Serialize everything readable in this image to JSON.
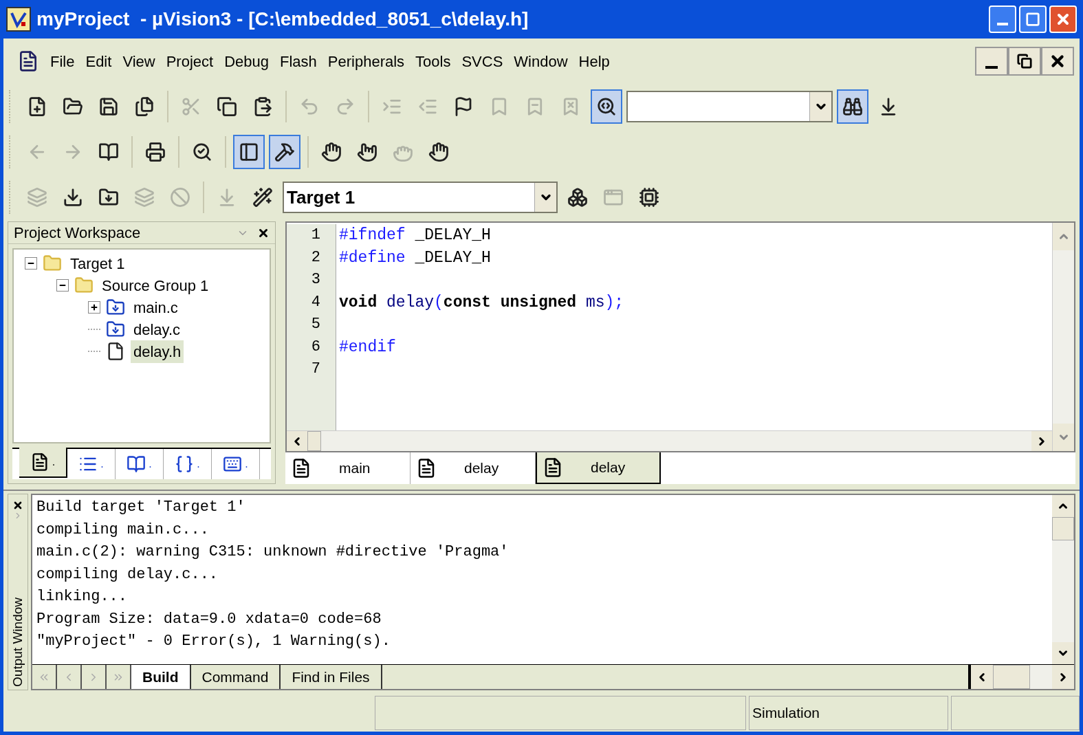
{
  "window": {
    "title": "myProject  - µVision3 - [C:\\embedded_8051_c\\delay.h]"
  },
  "menu": [
    "File",
    "Edit",
    "View",
    "Project",
    "Debug",
    "Flash",
    "Peripherals",
    "Tools",
    "SVCS",
    "Window",
    "Help"
  ],
  "toolbars": [
    {
      "items": [
        {
          "kind": "button",
          "disabled": false,
          "pressed": false
        },
        {
          "kind": "button",
          "disabled": false,
          "pressed": false
        },
        {
          "kind": "button",
          "disabled": false,
          "pressed": false
        },
        {
          "kind": "button",
          "disabled": false,
          "pressed": false
        },
        {
          "kind": "separator"
        },
        {
          "kind": "button",
          "disabled": true,
          "pressed": false
        },
        {
          "kind": "button",
          "disabled": false,
          "pressed": false
        },
        {
          "kind": "button",
          "disabled": false,
          "pressed": false
        },
        {
          "kind": "separator"
        },
        {
          "kind": "button",
          "disabled": true,
          "pressed": false
        },
        {
          "kind": "button",
          "disabled": true,
          "pressed": false
        },
        {
          "kind": "separator"
        },
        {
          "kind": "button",
          "disabled": true,
          "pressed": false
        },
        {
          "kind": "button",
          "disabled": true,
          "pressed": false
        },
        {
          "kind": "button",
          "disabled": false,
          "pressed": false
        },
        {
          "kind": "button",
          "disabled": true,
          "pressed": false
        },
        {
          "kind": "button",
          "disabled": true,
          "pressed": false
        },
        {
          "kind": "button",
          "disabled": true,
          "pressed": false
        },
        {
          "kind": "button",
          "disabled": false,
          "pressed": true
        },
        {
          "kind": "combo"
        },
        {
          "kind": "button",
          "disabled": false,
          "pressed": true
        },
        {
          "kind": "button",
          "disabled": false,
          "pressed": false
        }
      ]
    },
    {
      "items": [
        {
          "kind": "button",
          "disabled": true,
          "pressed": false
        },
        {
          "kind": "button",
          "disabled": true,
          "pressed": false
        },
        {
          "kind": "button",
          "disabled": false,
          "pressed": false
        },
        {
          "kind": "separator"
        },
        {
          "kind": "button",
          "disabled": false,
          "pressed": false
        },
        {
          "kind": "separator"
        },
        {
          "kind": "button",
          "disabled": false,
          "pressed": false
        },
        {
          "kind": "separator"
        },
        {
          "kind": "button",
          "disabled": false,
          "pressed": true
        },
        {
          "kind": "button",
          "disabled": false,
          "pressed": true
        },
        {
          "kind": "separator"
        },
        {
          "kind": "button",
          "disabled": false,
          "pressed": false
        },
        {
          "kind": "button",
          "disabled": false,
          "pressed": false
        },
        {
          "kind": "button",
          "disabled": true,
          "pressed": false
        },
        {
          "kind": "button",
          "disabled": false,
          "pressed": false
        }
      ]
    },
    {
      "items": [
        {
          "kind": "button",
          "disabled": true,
          "pressed": false
        },
        {
          "kind": "button",
          "disabled": false,
          "pressed": false
        },
        {
          "kind": "button",
          "disabled": false,
          "pressed": false
        },
        {
          "kind": "button",
          "disabled": true,
          "pressed": false
        },
        {
          "kind": "button",
          "disabled": true,
          "pressed": false
        },
        {
          "kind": "separator"
        },
        {
          "kind": "button",
          "disabled": true,
          "pressed": false
        },
        {
          "kind": "button",
          "disabled": false,
          "pressed": false
        },
        {
          "kind": "combo",
          "value": "Target 1"
        },
        {
          "kind": "button",
          "disabled": false,
          "pressed": false
        },
        {
          "kind": "button",
          "disabled": true,
          "pressed": false
        },
        {
          "kind": "button",
          "disabled": false,
          "pressed": false
        }
      ]
    }
  ],
  "workspace": {
    "title": "Project Workspace",
    "tree": [
      {
        "label": "Target 1",
        "kind": "target",
        "expanded": true,
        "children": [
          {
            "label": "Source Group 1",
            "kind": "group",
            "expanded": true,
            "children": [
              {
                "label": "main.c",
                "kind": "source",
                "expanded": false,
                "selected": false
              },
              {
                "label": "delay.c",
                "kind": "source",
                "selected": false
              },
              {
                "label": "delay.h",
                "kind": "header",
                "selected": true
              }
            ]
          }
        ]
      }
    ],
    "tabs": [
      {
        "label": ".",
        "selected": true
      },
      {
        "label": ".",
        "selected": false
      },
      {
        "label": ".",
        "selected": false
      },
      {
        "label": ".",
        "selected": false
      },
      {
        "label": ".",
        "selected": false
      }
    ]
  },
  "editor": {
    "lines": [
      {
        "number": "1",
        "tokens": [
          {
            "text": "#ifndef",
            "kind": "directive"
          },
          {
            "text": " _DELAY_H",
            "kind": "plain"
          }
        ]
      },
      {
        "number": "2",
        "tokens": [
          {
            "text": "#define",
            "kind": "directive"
          },
          {
            "text": " _DELAY_H",
            "kind": "plain"
          }
        ]
      },
      {
        "number": "3"
      },
      {
        "number": "4",
        "tokens": [
          {
            "text": "void",
            "kind": "keyword"
          },
          {
            "text": " delay",
            "kind": "ident"
          },
          {
            "text": "(",
            "kind": "punct"
          },
          {
            "text": "const",
            "kind": "keyword"
          },
          {
            "text": " unsigned",
            "kind": "keyword"
          },
          {
            "text": " ms",
            "kind": "ident"
          },
          {
            "text": ");",
            "kind": "punct"
          }
        ]
      },
      {
        "number": "5"
      },
      {
        "number": "6",
        "tokens": [
          {
            "text": "#endif",
            "kind": "directive"
          }
        ]
      },
      {
        "number": "7"
      }
    ],
    "tabs": [
      {
        "label": "main",
        "selected": false
      },
      {
        "label": "delay",
        "selected": false
      },
      {
        "label": "delay",
        "selected": true
      }
    ]
  },
  "output": {
    "title": "Output Window",
    "lines": [
      "Build target 'Target 1'",
      "compiling main.c...",
      "main.c(2): warning C315: unknown #directive 'Pragma'",
      "compiling delay.c...",
      "linking...",
      "Program Size: data=9.0 xdata=0 code=68",
      "\"myProject\" - 0 Error(s), 1 Warning(s)."
    ],
    "tabs": [
      {
        "label": "Build",
        "selected": true
      },
      {
        "label": "Command",
        "selected": false
      },
      {
        "label": "Find in Files",
        "selected": false
      }
    ]
  },
  "status_bar": {
    "mode": "Simulation"
  }
}
